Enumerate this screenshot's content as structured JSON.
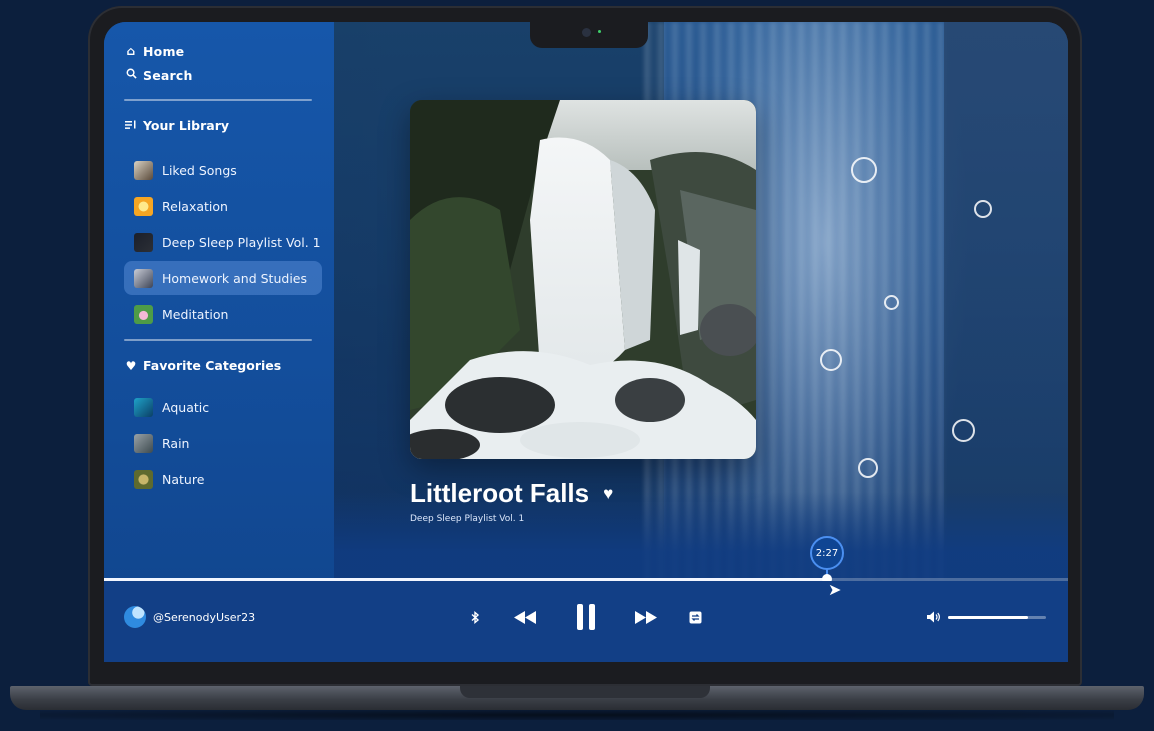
{
  "sidebar": {
    "nav": [
      {
        "label": "Home",
        "icon": "home-icon"
      },
      {
        "label": "Search",
        "icon": "search-icon"
      }
    ],
    "library_title": "Your Library",
    "library": [
      {
        "label": "Liked Songs"
      },
      {
        "label": "Relaxation"
      },
      {
        "label": "Deep Sleep Playlist Vol. 1"
      },
      {
        "label": "Homework and Studies",
        "active": true
      },
      {
        "label": "Meditation"
      }
    ],
    "categories_title": "Favorite Categories",
    "categories": [
      {
        "label": "Aquatic"
      },
      {
        "label": "Rain"
      },
      {
        "label": "Nature"
      }
    ]
  },
  "now_playing": {
    "title": "Littleroot Falls",
    "playlist": "Deep Sleep Playlist Vol. 1",
    "elapsed": "2:27",
    "progress": 0.75
  },
  "player": {
    "username": "@SerenodyUser23",
    "volume": 0.82
  },
  "colors": {
    "accent": "#4b8ff0",
    "sidebar": "#1657aa",
    "player_bar": "#123f86"
  }
}
